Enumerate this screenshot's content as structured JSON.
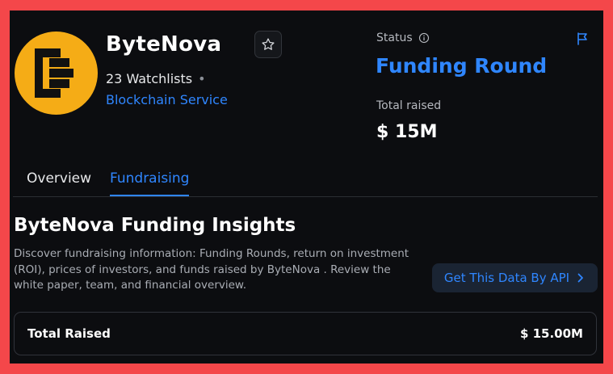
{
  "project": {
    "name": "ByteNova",
    "watchlists": "23 Watchlists",
    "separator": "•",
    "category": "Blockchain Service"
  },
  "status": {
    "label": "Status",
    "value": "Funding Round"
  },
  "total_raised": {
    "label": "Total raised",
    "value": "$ 15M"
  },
  "tabs": [
    {
      "label": "Overview",
      "active": false
    },
    {
      "label": "Fundraising",
      "active": true
    }
  ],
  "insights": {
    "title": "ByteNova Funding Insights",
    "description": "Discover fundraising information: Funding Rounds, return on investment (ROI), prices of investors, and funds raised by ByteNova . Review the white paper, team, and financial overview.",
    "api_button": "Get This Data By API"
  },
  "summary": {
    "label": "Total Raised",
    "value": "$ 15.00M"
  },
  "colors": {
    "accent": "#2f86ff",
    "logo": "#f5ac16",
    "border": "#f4474a",
    "background": "#0c0d10"
  },
  "icons": [
    "bytenova-logo-icon",
    "star-icon",
    "info-icon",
    "flag-icon",
    "chevron-right-icon"
  ]
}
